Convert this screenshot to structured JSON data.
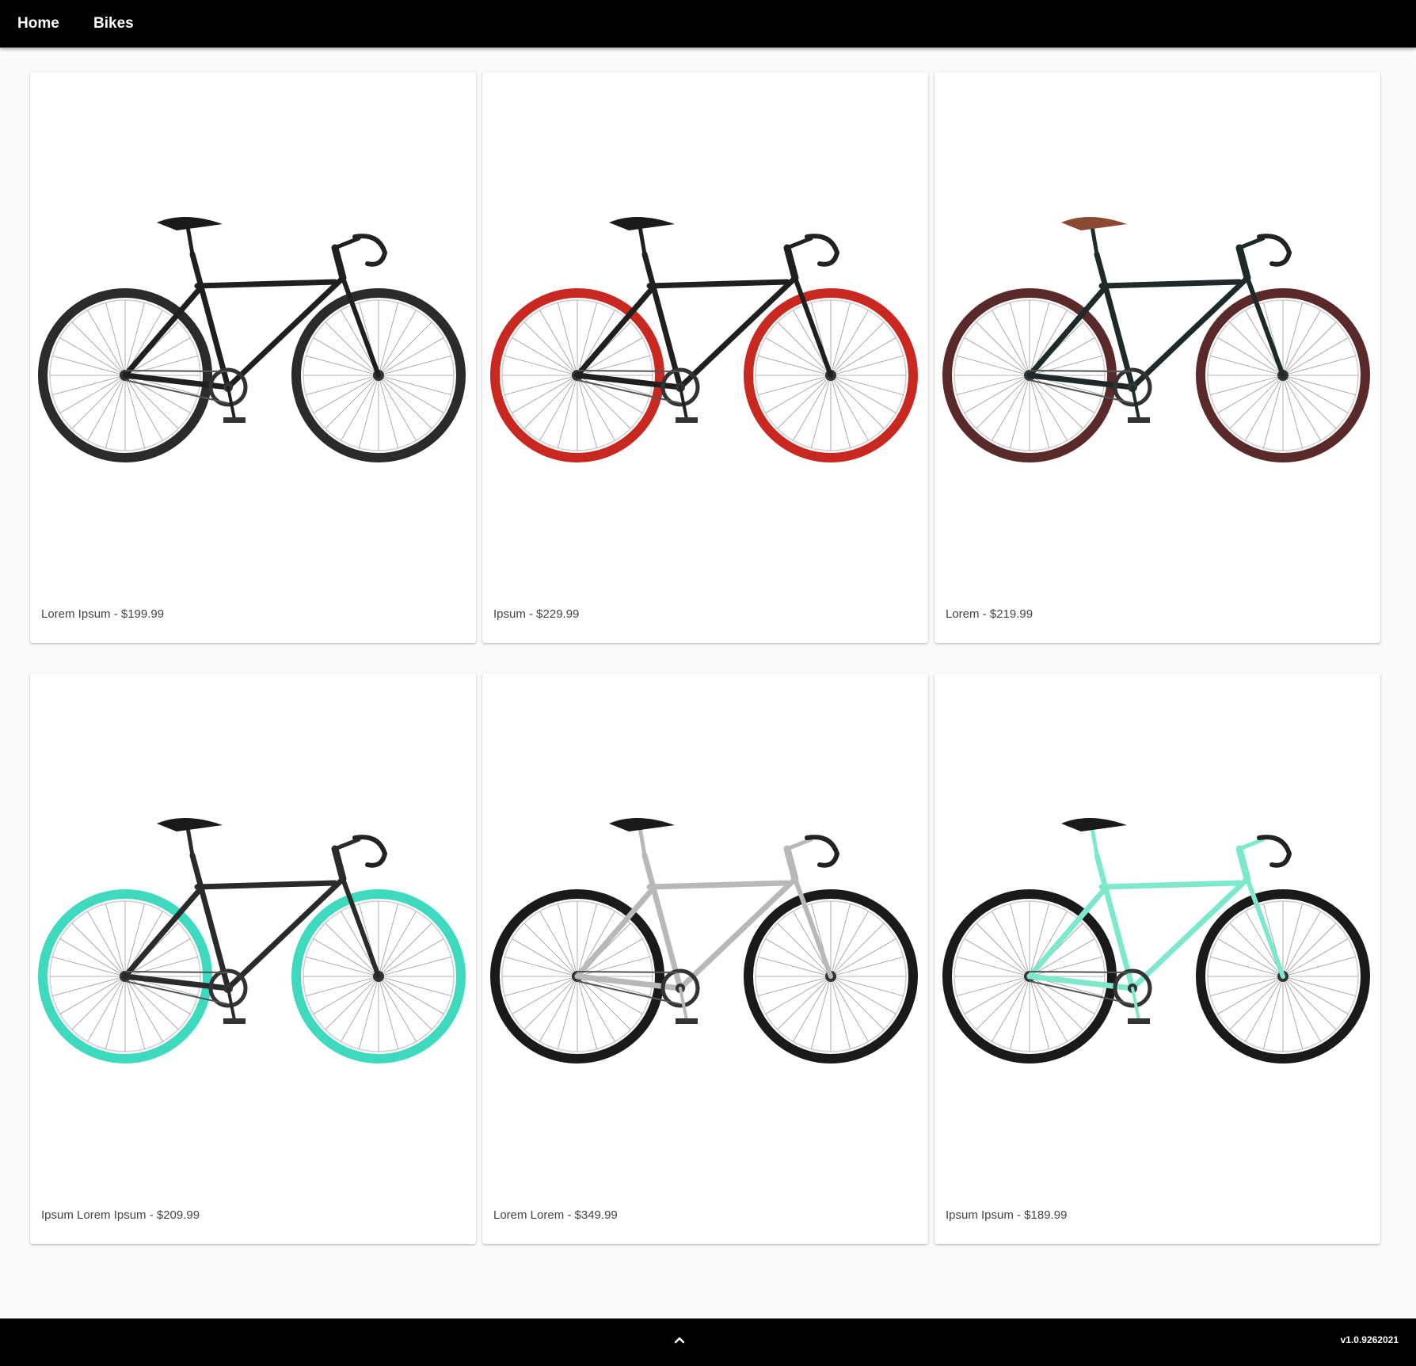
{
  "nav": {
    "home_label": "Home",
    "bikes_label": "Bikes"
  },
  "products": [
    {
      "caption": "Lorem Ipsum - $199.99",
      "frame_color": "#1f1f1f",
      "wheel_color": "#2b2b2b",
      "saddle_color": "#1a1a1a"
    },
    {
      "caption": "Ipsum - $229.99",
      "frame_color": "#1f1f1f",
      "wheel_color": "#c8281f",
      "saddle_color": "#1a1a1a"
    },
    {
      "caption": "Lorem - $219.99",
      "frame_color": "#1e2a2a",
      "wheel_color": "#5a2a2a",
      "saddle_color": "#8a4a32"
    },
    {
      "caption": "Ipsum Lorem Ipsum - $209.99",
      "frame_color": "#2a2a2a",
      "wheel_color": "#3fd9c0",
      "saddle_color": "#1a1a1a"
    },
    {
      "caption": "Lorem Lorem - $349.99",
      "frame_color": "#b8b8b8",
      "wheel_color": "#1a1a1a",
      "saddle_color": "#1a1a1a"
    },
    {
      "caption": "Ipsum Ipsum - $189.99",
      "frame_color": "#7ee8cc",
      "wheel_color": "#1a1a1a",
      "saddle_color": "#1a1a1a"
    }
  ],
  "footer": {
    "version": "v1.0.9262021",
    "scroll_top_icon": "chevron-up-icon"
  }
}
